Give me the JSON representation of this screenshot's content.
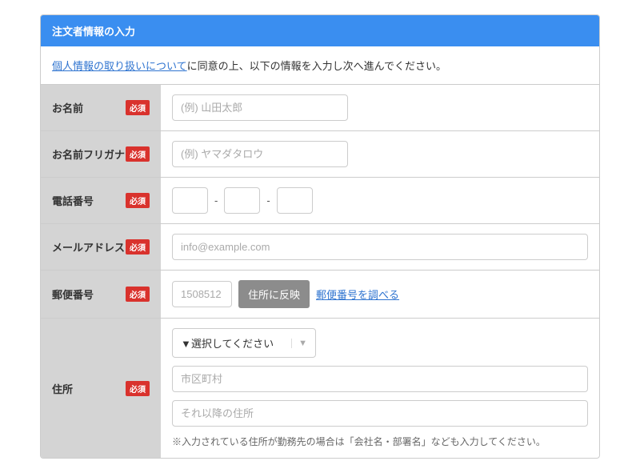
{
  "header": {
    "title": "注文者情報の入力"
  },
  "intro": {
    "link_text": "個人情報の取り扱いについて",
    "after_text": "に同意の上、以下の情報を入力し次へ進んでください。"
  },
  "labels": {
    "name": "お名前",
    "name_kana": "お名前フリガナ",
    "phone": "電話番号",
    "email": "メールアドレス",
    "postal": "郵便番号",
    "address": "住所",
    "required_badge": "必須"
  },
  "placeholders": {
    "name": "(例) 山田太郎",
    "name_kana": "(例) ヤマダタロウ",
    "email": "info@example.com",
    "postal": "1508512",
    "city": "市区町村",
    "rest": "それ以降の住所"
  },
  "postal": {
    "apply_button": "住所に反映",
    "lookup_link": "郵便番号を調べる"
  },
  "address": {
    "select_placeholder": "▼選択してください",
    "helper": "※入力されている住所が勤務先の場合は「会社名・部署名」なども入力してください。"
  }
}
